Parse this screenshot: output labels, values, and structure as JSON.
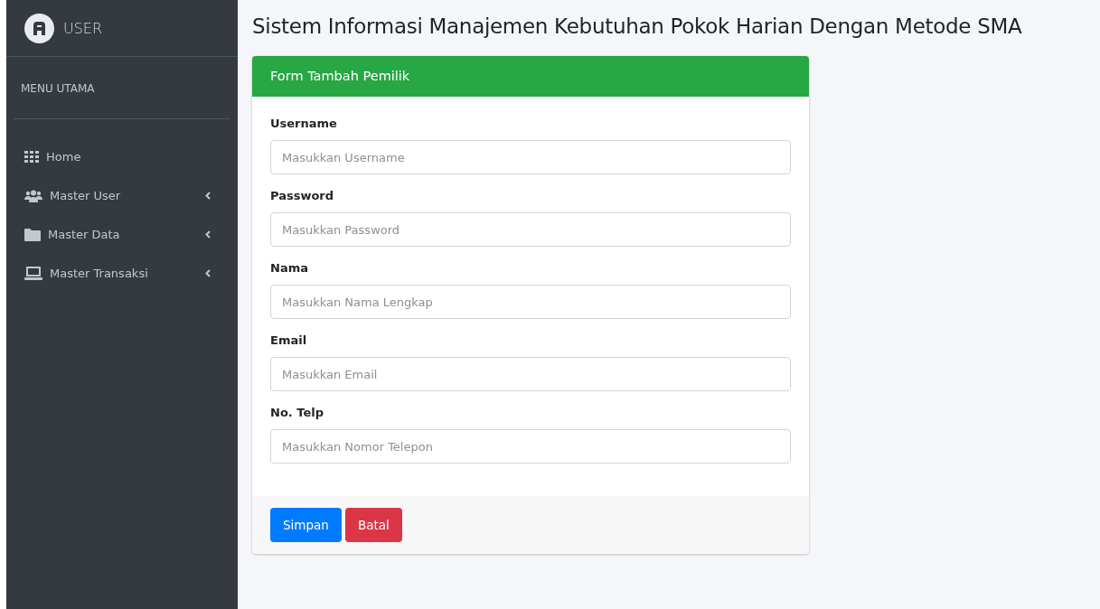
{
  "sidebar": {
    "brand": "USER",
    "section_title": "MENU UTAMA",
    "items": [
      {
        "label": "Home",
        "collapsible": false
      },
      {
        "label": "Master User",
        "collapsible": true
      },
      {
        "label": "Master Data",
        "collapsible": true
      },
      {
        "label": "Master Transaksi",
        "collapsible": true
      }
    ]
  },
  "page_title": "Sistem Informasi Manajemen Kebutuhan Pokok Harian Dengan Metode SMA",
  "form": {
    "title": "Form Tambah Pemilik",
    "fields": [
      {
        "label": "Username",
        "placeholder": "Masukkan Username"
      },
      {
        "label": "Password",
        "placeholder": "Masukkan Password"
      },
      {
        "label": "Nama",
        "placeholder": "Masukkan Nama Lengkap"
      },
      {
        "label": "Email",
        "placeholder": "Masukkan Email"
      },
      {
        "label": "No. Telp",
        "placeholder": "Masukkan Nomor Telepon"
      }
    ],
    "buttons": [
      {
        "label": "Simpan",
        "kind": "primary"
      },
      {
        "label": "Batal",
        "kind": "danger"
      }
    ]
  }
}
